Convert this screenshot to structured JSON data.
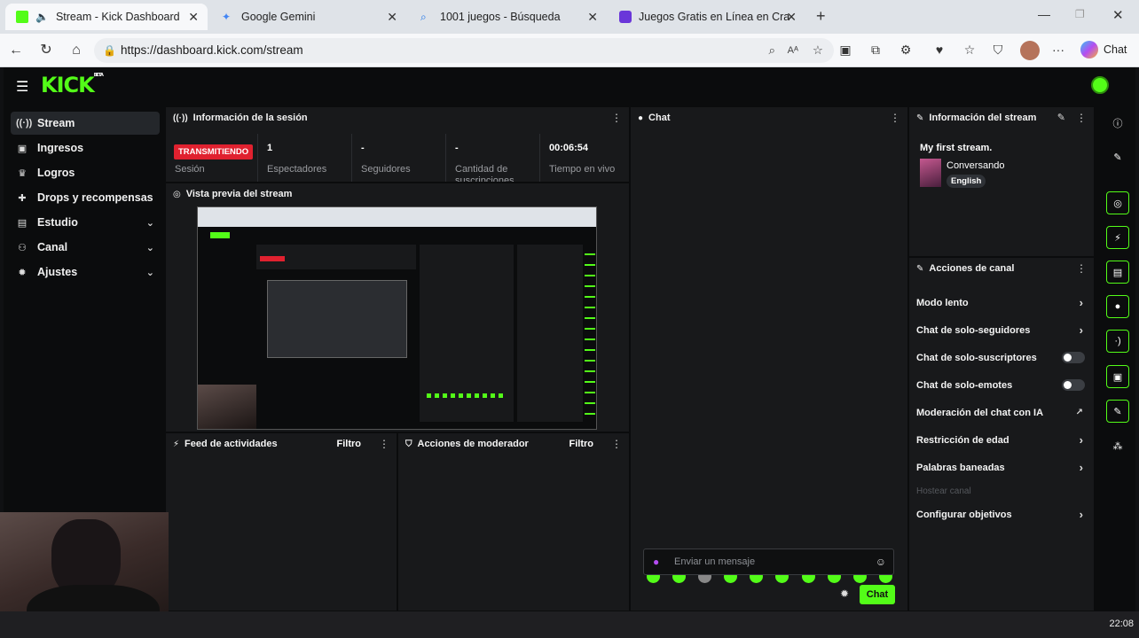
{
  "browser": {
    "tabs": [
      {
        "label": "Stream - Kick Dashboard",
        "active": true
      },
      {
        "label": "Google Gemini",
        "active": false
      },
      {
        "label": "1001 juegos - Búsqueda",
        "active": false
      },
      {
        "label": "Juegos Gratis en Línea en CrazyGa",
        "active": false
      }
    ],
    "url": "https://dashboard.kick.com/stream",
    "chat_label": "Chat"
  },
  "app": {
    "logo": "KICK",
    "logo_tag": "BETA",
    "accent": "#53fc18"
  },
  "sidebar": {
    "items": [
      {
        "label": "Stream",
        "icon": "broadcast-icon"
      },
      {
        "label": "Ingresos",
        "icon": "wallet-icon"
      },
      {
        "label": "Logros",
        "icon": "trophy-icon"
      },
      {
        "label": "Drops y recompensas",
        "icon": "gift-icon"
      },
      {
        "label": "Estudio",
        "icon": "studio-icon"
      },
      {
        "label": "Canal",
        "icon": "users-icon"
      },
      {
        "label": "Ajustes",
        "icon": "gear-icon"
      }
    ]
  },
  "session": {
    "title": "Información de la sesión",
    "live_badge": "TRANSMITIENDO",
    "stats": [
      {
        "value": "",
        "label": "Sesión"
      },
      {
        "value": "1",
        "label": "Espectadores"
      },
      {
        "value": "-",
        "label": "Seguidores"
      },
      {
        "value": "-",
        "label": "Cantidad de suscripciones"
      },
      {
        "value": "00:06:54",
        "label": "Tiempo en vivo"
      }
    ]
  },
  "preview": {
    "title": "Vista previa del stream"
  },
  "activity": {
    "title": "Feed de actividades",
    "filter": "Filtro"
  },
  "moderator": {
    "title": "Acciones de moderador",
    "filter": "Filtro"
  },
  "chat": {
    "title": "Chat",
    "placeholder": "Enviar un mensaje",
    "send_label": "Chat"
  },
  "stream_info": {
    "title": "Información del stream",
    "stream_title": "My first stream.",
    "category": "Conversando",
    "language": "English"
  },
  "channel_actions": {
    "title": "Acciones de canal",
    "rows": [
      {
        "label": "Modo lento",
        "control": "arrow"
      },
      {
        "label": "Chat de solo-seguidores",
        "control": "arrow"
      },
      {
        "label": "Chat de solo-suscriptores",
        "control": "toggle"
      },
      {
        "label": "Chat de solo-emotes",
        "control": "toggle"
      },
      {
        "label": "Moderación del chat con IA",
        "control": "external"
      },
      {
        "label": "Restricción de edad",
        "control": "arrow"
      },
      {
        "label": "Palabras baneadas",
        "control": "arrow"
      },
      {
        "label": "Hostear canal",
        "control": "disabled"
      },
      {
        "label": "Configurar objetivos",
        "control": "arrow"
      }
    ]
  },
  "taskbar": {
    "time": "22:08"
  }
}
